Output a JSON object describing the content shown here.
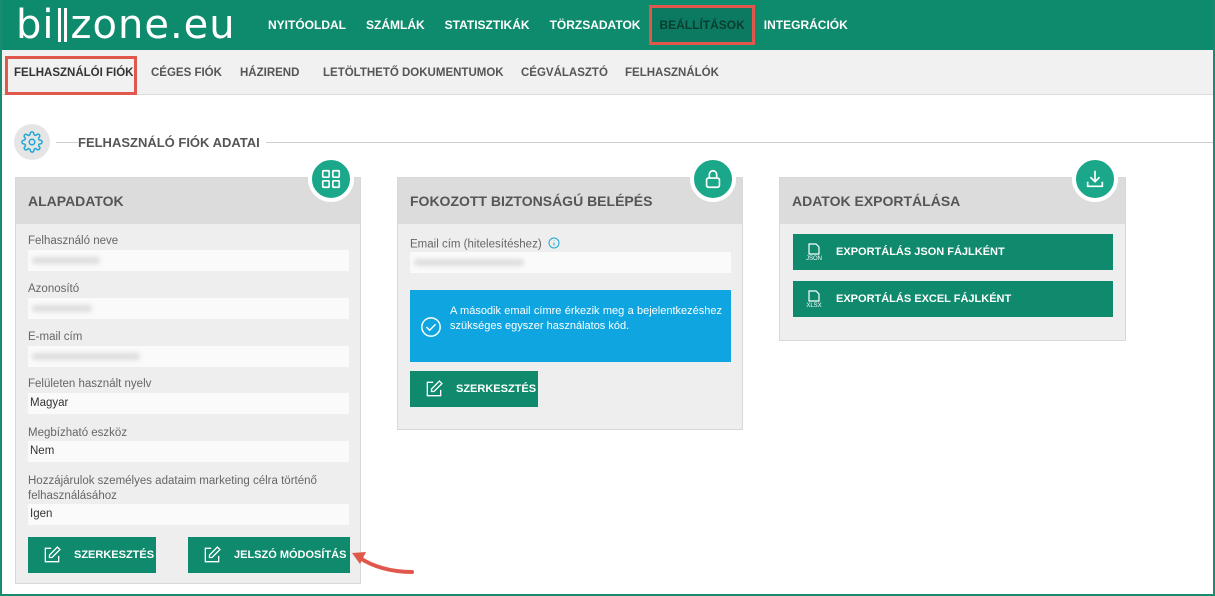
{
  "logo": {
    "prefix": "bi",
    "suffix": "zone.eu"
  },
  "topnav": [
    {
      "label": "NYITÓOLDAL"
    },
    {
      "label": "SZÁMLÁK"
    },
    {
      "label": "STATISZTIKÁK"
    },
    {
      "label": "TÖRZSADATOK"
    },
    {
      "label": "BEÁLLÍTÁSOK"
    },
    {
      "label": "INTEGRÁCIÓK"
    }
  ],
  "subnav": [
    {
      "label": "FELHASZNÁLÓI FIÓK"
    },
    {
      "label": "CÉGES FIÓK"
    },
    {
      "label": "HÁZIREND"
    },
    {
      "label": "LETÖLTHETŐ DOKUMENTUMOK"
    },
    {
      "label": "CÉGVÁLASZTÓ"
    },
    {
      "label": "FELHASZNÁLÓK"
    }
  ],
  "section_title": "FELHASZNÁLÓ FIÓK ADATAI",
  "basic": {
    "title": "ALAPADATOK",
    "fields": [
      {
        "label": "Felhasználó neve",
        "value": ""
      },
      {
        "label": "Azonosító",
        "value": ""
      },
      {
        "label": "E-mail cím",
        "value": ""
      },
      {
        "label": "Felületen használt nyelv",
        "value": "Magyar"
      },
      {
        "label": "Megbízható eszköz",
        "value": "Nem"
      },
      {
        "label": "Hozzájárulok személyes adataim marketing célra történő felhasználásához",
        "value": "Igen"
      }
    ],
    "edit_label": "SZERKESZTÉS",
    "password_label": "JELSZÓ MÓDOSÍTÁS"
  },
  "security": {
    "title": "FOKOZOTT BIZTONSÁGÚ BELÉPÉS",
    "email_label": "Email cím (hitelesítéshez)",
    "email_value": "",
    "info": "A második email címre érkezik meg a bejelentkezéshez szükséges egyszer használatos kód.",
    "edit_label": "SZERKESZTÉS"
  },
  "export": {
    "title": "ADATOK EXPORTÁLÁSA",
    "json_label": "EXPORTÁLÁS JSON FÁJLKÉNT",
    "json_tag": "JSON",
    "excel_label": "EXPORTÁLÁS EXCEL FÁJLKÉNT",
    "excel_tag": "XLSX"
  },
  "colors": {
    "brand": "#0e8a6c",
    "badge": "#1ba88a",
    "info": "#0ea5e0",
    "highlight": "#e0584b"
  }
}
